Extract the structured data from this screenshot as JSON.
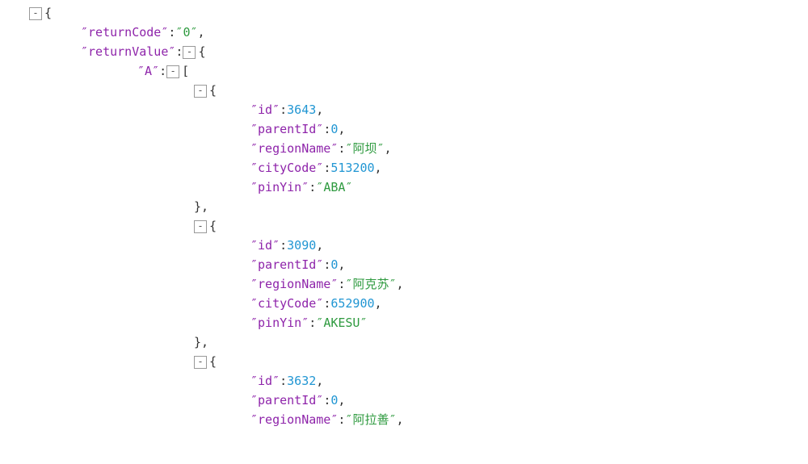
{
  "glyphs": {
    "q": "″"
  },
  "root": {
    "returnCode": "0",
    "returnValue": {
      "A": [
        {
          "id": 3643,
          "parentId": 0,
          "regionName": "阿坝",
          "cityCode": 513200,
          "pinYin": "ABA"
        },
        {
          "id": 3090,
          "parentId": 0,
          "regionName": "阿克苏",
          "cityCode": 652900,
          "pinYin": "AKESU"
        },
        {
          "id": 3632,
          "parentId": 0,
          "regionName": "阿拉善"
        }
      ]
    }
  },
  "keys": {
    "returnCode": "returnCode",
    "returnValue": "returnValue",
    "A": "A",
    "id": "id",
    "parentId": "parentId",
    "regionName": "regionName",
    "cityCode": "cityCode",
    "pinYin": "pinYin"
  }
}
